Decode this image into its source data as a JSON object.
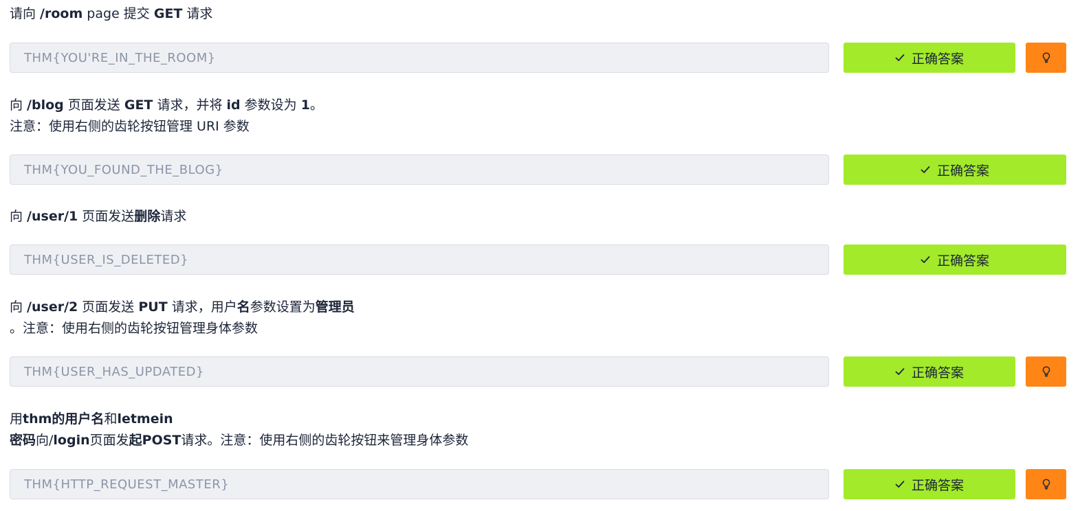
{
  "tasks": [
    {
      "question_lines": [
        [
          {
            "text": "请向 ",
            "bold": false
          },
          {
            "text": "/room",
            "bold": true
          },
          {
            "text": " page 提交 ",
            "bold": false
          },
          {
            "text": "GET",
            "bold": true
          },
          {
            "text": " 请求",
            "bold": false
          }
        ]
      ],
      "answer_value": "THM{YOU'RE_IN_THE_ROOM}",
      "correct_label": "正确答案",
      "has_hint": true
    },
    {
      "question_lines": [
        [
          {
            "text": "向 ",
            "bold": false
          },
          {
            "text": "/blog",
            "bold": true
          },
          {
            "text": " 页面发送 ",
            "bold": false
          },
          {
            "text": "GET",
            "bold": true
          },
          {
            "text": " 请求，并将 ",
            "bold": false
          },
          {
            "text": "id",
            "bold": true
          },
          {
            "text": " 参数设为 ",
            "bold": false
          },
          {
            "text": "1",
            "bold": true
          },
          {
            "text": "。",
            "bold": false
          }
        ],
        [
          {
            "text": "注意：使用右侧的齿轮按钮管理 URI 参数",
            "bold": false
          }
        ]
      ],
      "answer_value": "THM{YOU_FOUND_THE_BLOG}",
      "correct_label": "正确答案",
      "has_hint": false
    },
    {
      "question_lines": [
        [
          {
            "text": "向 ",
            "bold": false
          },
          {
            "text": "/user/1",
            "bold": true
          },
          {
            "text": " 页面发送",
            "bold": false
          },
          {
            "text": "删除",
            "bold": true
          },
          {
            "text": "请求",
            "bold": false
          }
        ]
      ],
      "answer_value": "THM{USER_IS_DELETED}",
      "correct_label": "正确答案",
      "has_hint": false
    },
    {
      "question_lines": [
        [
          {
            "text": "向 ",
            "bold": false
          },
          {
            "text": "/user/2",
            "bold": true
          },
          {
            "text": " 页面发送 ",
            "bold": false
          },
          {
            "text": "PUT",
            "bold": true
          },
          {
            "text": " 请求，用户",
            "bold": false
          },
          {
            "text": "名",
            "bold": true
          },
          {
            "text": "参数设置为",
            "bold": false
          },
          {
            "text": "管理员",
            "bold": true
          }
        ],
        [
          {
            "text": "。注意：使用右侧的齿轮按钮管理身体参数",
            "bold": false
          }
        ]
      ],
      "answer_value": "THM{USER_HAS_UPDATED}",
      "correct_label": "正确答案",
      "has_hint": true
    },
    {
      "question_lines": [
        [
          {
            "text": "用",
            "bold": false
          },
          {
            "text": "thm的用户名",
            "bold": true
          },
          {
            "text": "和",
            "bold": false
          },
          {
            "text": "letmein",
            "bold": true
          }
        ],
        [
          {
            "text": "密码",
            "bold": true
          },
          {
            "text": "向/",
            "bold": false
          },
          {
            "text": "login",
            "bold": true
          },
          {
            "text": "页面发",
            "bold": false
          },
          {
            "text": "起POST",
            "bold": true
          },
          {
            "text": "请求。注意：使用右侧的齿轮按钮来管理身体参数",
            "bold": false
          }
        ]
      ],
      "answer_value": "THM{HTTP_REQUEST_MASTER}",
      "correct_label": "正确答案",
      "has_hint": true
    }
  ],
  "icons": {
    "correct": "check-icon",
    "hint": "lightbulb-icon"
  },
  "colors": {
    "correct_button": "#a3ea2a",
    "hint_button": "#ff8516",
    "input_background": "#eef0f4",
    "text": "#1c2538",
    "input_text": "#8c95a6"
  }
}
